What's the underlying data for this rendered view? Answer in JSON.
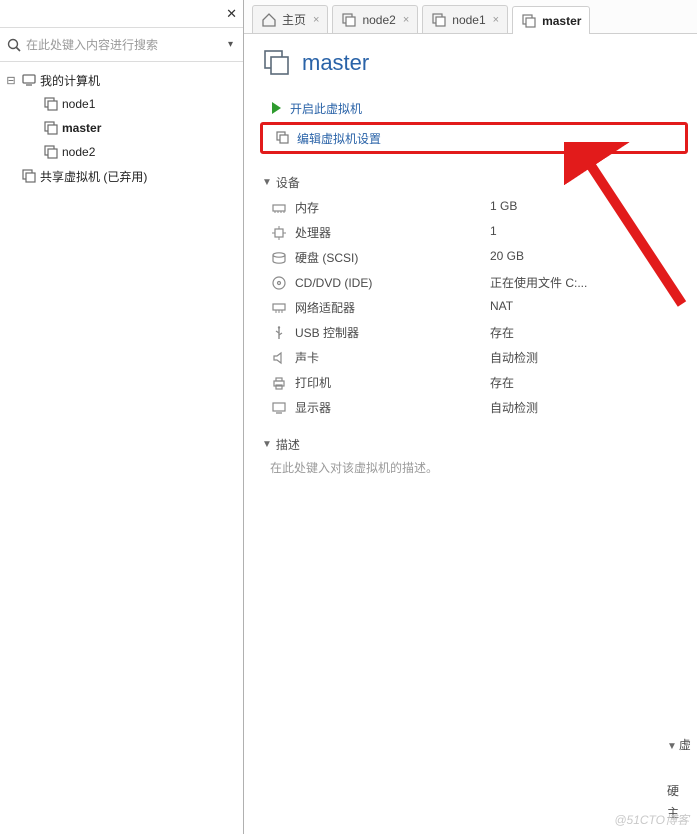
{
  "sidebar": {
    "close_icon_name": "close-icon",
    "search_placeholder": "在此处键入内容进行搜索",
    "tree": {
      "root": {
        "label": "我的计算机"
      },
      "children": [
        {
          "label": "node1"
        },
        {
          "label": "master",
          "active": true
        },
        {
          "label": "node2"
        }
      ],
      "shared": {
        "label": "共享虚拟机 (已弃用)"
      }
    }
  },
  "tabs": [
    {
      "label": "主页",
      "icon": "home-icon",
      "active": false,
      "closable": false
    },
    {
      "label": "node2",
      "icon": "vm-icon",
      "active": false,
      "closable": true
    },
    {
      "label": "node1",
      "icon": "vm-icon",
      "active": false,
      "closable": true
    },
    {
      "label": "master",
      "icon": "vm-icon",
      "active": true,
      "closable": false
    }
  ],
  "page": {
    "title": "master",
    "actions": {
      "power_on": "开启此虚拟机",
      "edit_settings": "编辑虚拟机设置"
    },
    "sections": {
      "devices_label": "设备",
      "description_label": "描述",
      "description_placeholder": "在此处键入对该虚拟机的描述。",
      "side_label": "虚",
      "side_rows": [
        "硬",
        "主"
      ]
    },
    "devices": [
      {
        "icon": "memory-icon",
        "name": "内存",
        "value": "1 GB"
      },
      {
        "icon": "cpu-icon",
        "name": "处理器",
        "value": "1"
      },
      {
        "icon": "disk-icon",
        "name": "硬盘 (SCSI)",
        "value": "20 GB"
      },
      {
        "icon": "disc-icon",
        "name": "CD/DVD (IDE)",
        "value": "正在使用文件 C:..."
      },
      {
        "icon": "network-icon",
        "name": "网络适配器",
        "value": "NAT"
      },
      {
        "icon": "usb-icon",
        "name": "USB 控制器",
        "value": "存在"
      },
      {
        "icon": "sound-icon",
        "name": "声卡",
        "value": "自动检测"
      },
      {
        "icon": "printer-icon",
        "name": "打印机",
        "value": "存在"
      },
      {
        "icon": "display-icon",
        "name": "显示器",
        "value": "自动检测"
      }
    ]
  },
  "annotation": {
    "arrow_color": "#e21b1b"
  },
  "watermark": "@51CTO博客"
}
